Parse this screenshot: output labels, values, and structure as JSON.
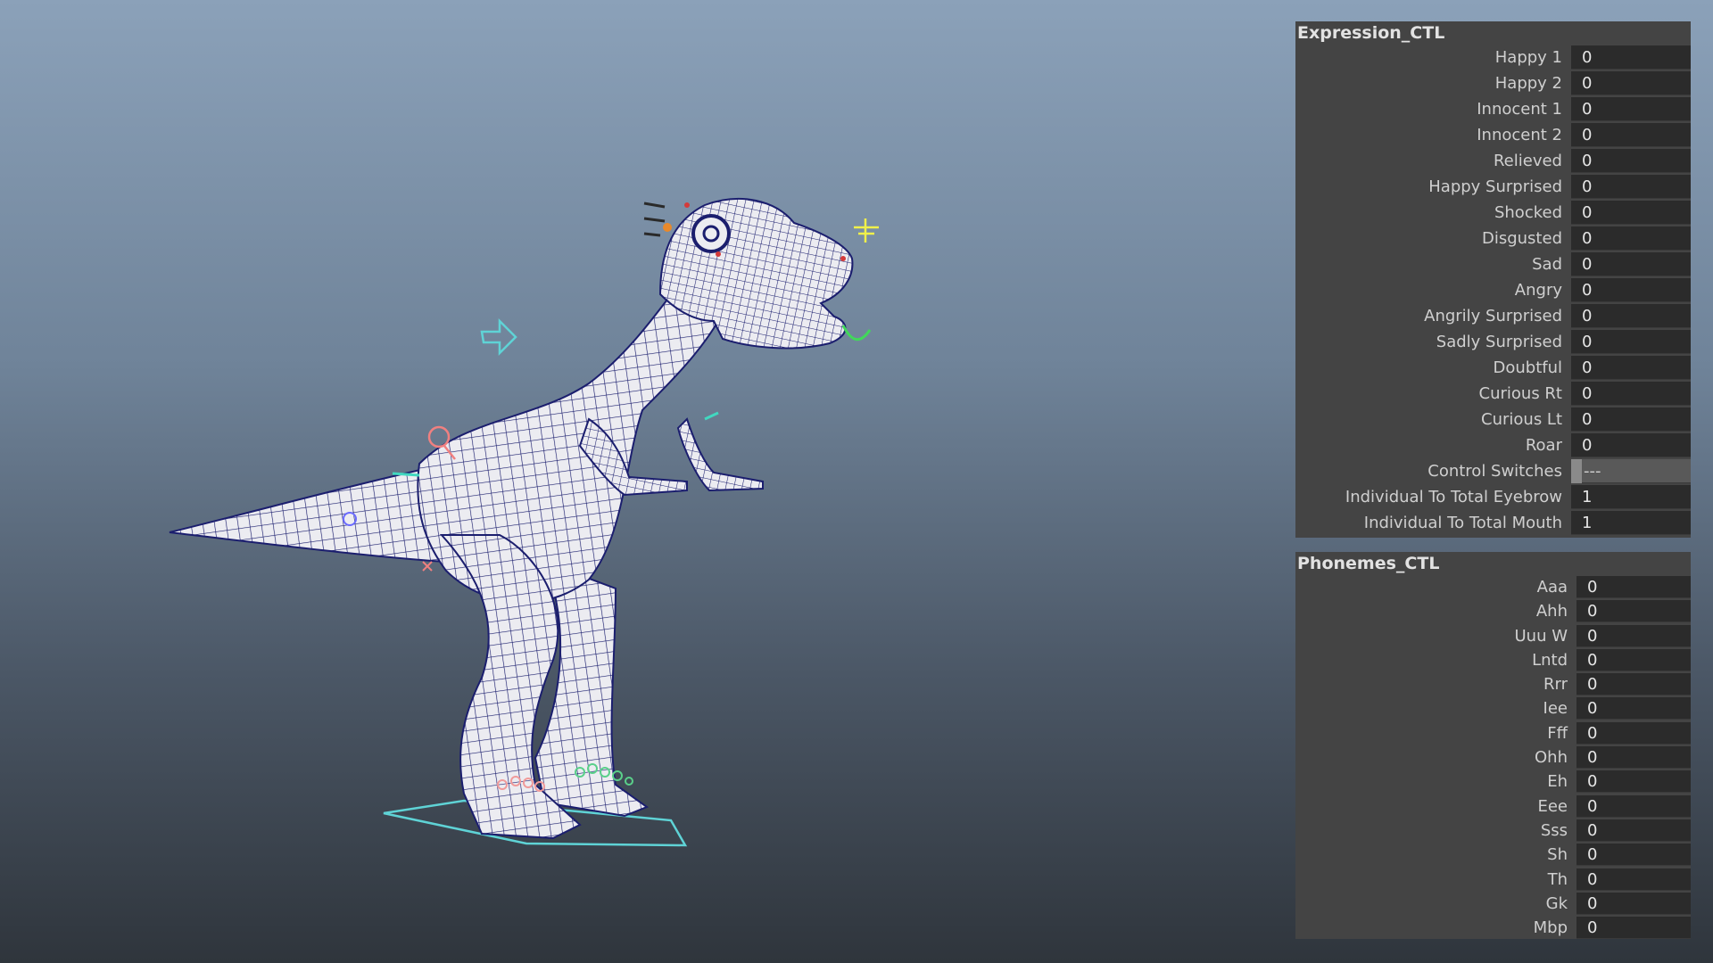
{
  "expression_ctl": {
    "title": "Expression_CTL",
    "rows": [
      {
        "label": "Happy 1",
        "value": "0"
      },
      {
        "label": "Happy 2",
        "value": "0"
      },
      {
        "label": "Innocent 1",
        "value": "0"
      },
      {
        "label": "Innocent 2",
        "value": "0"
      },
      {
        "label": "Relieved",
        "value": "0"
      },
      {
        "label": "Happy Surprised",
        "value": "0"
      },
      {
        "label": "Shocked",
        "value": "0"
      },
      {
        "label": "Disgusted",
        "value": "0"
      },
      {
        "label": "Sad",
        "value": "0"
      },
      {
        "label": "Angry",
        "value": "0"
      },
      {
        "label": "Angrily Surprised",
        "value": "0"
      },
      {
        "label": "Sadly Surprised",
        "value": "0"
      },
      {
        "label": "Doubtful",
        "value": "0"
      },
      {
        "label": "Curious Rt",
        "value": "0"
      },
      {
        "label": "Curious Lt",
        "value": "0"
      },
      {
        "label": "Roar",
        "value": "0"
      },
      {
        "label": "Control Switches",
        "value": "---"
      },
      {
        "label": "Individual To Total Eyebrow",
        "value": "1"
      },
      {
        "label": "Individual To Total Mouth",
        "value": "1"
      }
    ]
  },
  "phonemes_ctl": {
    "title": "Phonemes_CTL",
    "rows": [
      {
        "label": "Aaa",
        "value": "0"
      },
      {
        "label": "Ahh",
        "value": "0"
      },
      {
        "label": "Uuu W",
        "value": "0"
      },
      {
        "label": "Lntd",
        "value": "0"
      },
      {
        "label": "Rrr",
        "value": "0"
      },
      {
        "label": "Iee",
        "value": "0"
      },
      {
        "label": "Fff",
        "value": "0"
      },
      {
        "label": "Ohh",
        "value": "0"
      },
      {
        "label": "Eh",
        "value": "0"
      },
      {
        "label": "Eee",
        "value": "0"
      },
      {
        "label": "Sss",
        "value": "0"
      },
      {
        "label": "Sh",
        "value": "0"
      },
      {
        "label": "Th",
        "value": "0"
      },
      {
        "label": "Gk",
        "value": "0"
      },
      {
        "label": "Mbp",
        "value": "0"
      }
    ]
  },
  "viewport": {
    "background_top": "#8ba1b9",
    "background_bottom": "#2f353c",
    "mesh_fill": "#e9e9ee",
    "wire_color": "#1b1e6e",
    "control_color": "#5ad0d0"
  }
}
